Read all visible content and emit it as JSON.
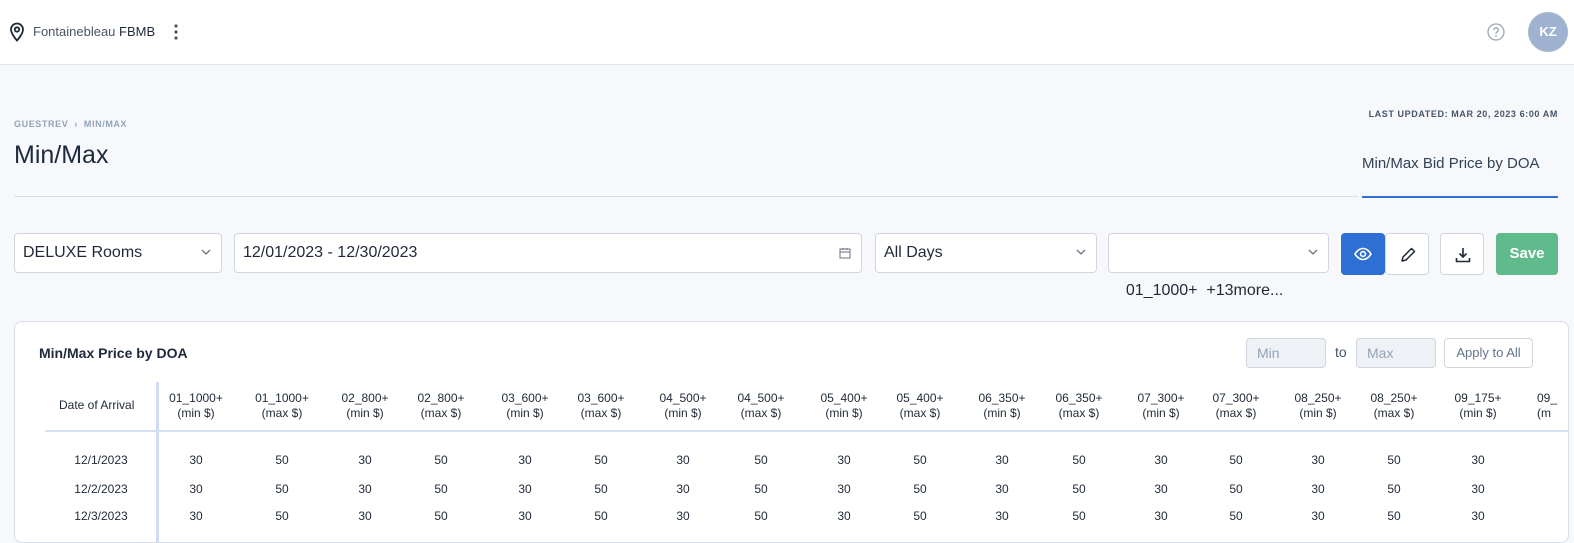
{
  "topbar": {
    "property_prefix": "Fontainebleau ",
    "property_code": "FBMB",
    "avatar_initials": "KZ"
  },
  "breadcrumb": [
    "GUESTREV",
    "MIN/MAX"
  ],
  "page_title": "Min/Max",
  "last_updated": "LAST UPDATED: MAR 20, 2023 6:00 AM",
  "tabs": [
    {
      "label": "Min/Max Bid Price by DOA",
      "active": true
    }
  ],
  "filters": {
    "room_type": "DELUXE Rooms",
    "date_range": "12/01/2023 - 12/30/2023",
    "days": "All Days",
    "segments": "01_1000+  +13more..."
  },
  "toolbar": {
    "save_label": "Save"
  },
  "card": {
    "title": "Min/Max Price by DOA",
    "min_placeholder": "Min",
    "to_label": "to",
    "max_placeholder": "Max",
    "apply_label": "Apply to All"
  },
  "table": {
    "date_header": "Date of Arrival",
    "columns": [
      [
        "01_1000+",
        "(min $)"
      ],
      [
        "01_1000+",
        "(max $)"
      ],
      [
        "02_800+",
        "(min $)"
      ],
      [
        "02_800+",
        "(max $)"
      ],
      [
        "03_600+",
        "(min $)"
      ],
      [
        "03_600+",
        "(max $)"
      ],
      [
        "04_500+",
        "(min $)"
      ],
      [
        "04_500+",
        "(max $)"
      ],
      [
        "05_400+",
        "(min $)"
      ],
      [
        "05_400+",
        "(max $)"
      ],
      [
        "06_350+",
        "(min $)"
      ],
      [
        "06_350+",
        "(max $)"
      ],
      [
        "07_300+",
        "(min $)"
      ],
      [
        "07_300+",
        "(max $)"
      ],
      [
        "08_250+",
        "(min $)"
      ],
      [
        "08_250+",
        "(max $)"
      ],
      [
        "09_175+",
        "(min $)"
      ],
      [
        "09_",
        "(m"
      ]
    ],
    "rows": [
      {
        "date": "12/1/2023",
        "values": [
          "30",
          "50",
          "30",
          "50",
          "30",
          "50",
          "30",
          "50",
          "30",
          "50",
          "30",
          "50",
          "30",
          "50",
          "30",
          "50",
          "30"
        ]
      },
      {
        "date": "12/2/2023",
        "values": [
          "30",
          "50",
          "30",
          "50",
          "30",
          "50",
          "30",
          "50",
          "30",
          "50",
          "30",
          "50",
          "30",
          "50",
          "30",
          "50",
          "30"
        ]
      },
      {
        "date": "12/3/2023",
        "values": [
          "30",
          "50",
          "30",
          "50",
          "30",
          "50",
          "30",
          "50",
          "30",
          "50",
          "30",
          "50",
          "30",
          "50",
          "30",
          "50",
          "30"
        ]
      }
    ]
  },
  "colors": {
    "primary": "#2d6fd2",
    "save": "#5fba8c",
    "avatar": "#9fb3d1"
  }
}
